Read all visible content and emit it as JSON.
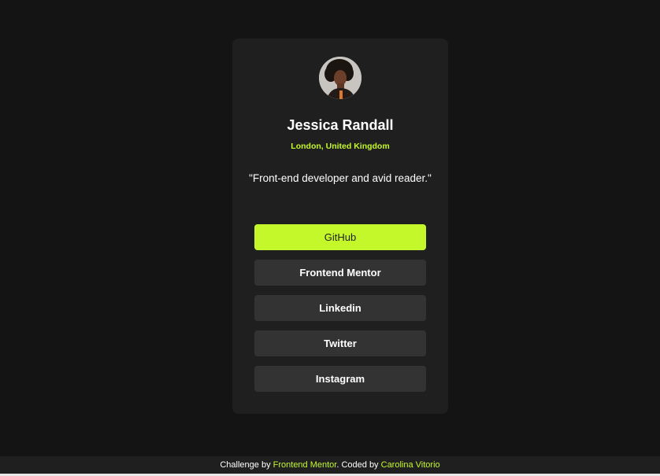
{
  "profile": {
    "name": "Jessica Randall",
    "location": "London, United Kingdom",
    "bio": "\"Front-end developer and avid reader.\""
  },
  "links": [
    {
      "label": "GitHub",
      "state": "active"
    },
    {
      "label": "Frontend Mentor",
      "state": "default"
    },
    {
      "label": "Linkedin",
      "state": "default"
    },
    {
      "label": "Twitter",
      "state": "default"
    },
    {
      "label": "Instagram",
      "state": "default"
    }
  ],
  "footer": {
    "challenge_prefix": "Challenge by ",
    "challenge_link": "Frontend Mentor",
    "coded_prefix": ". Coded by ",
    "author_link": "Carolina Vitorio"
  },
  "colors": {
    "background": "#141414",
    "card": "#1f1f1f",
    "button": "#333333",
    "accent": "#c4f82a",
    "text": "#ffffff"
  }
}
